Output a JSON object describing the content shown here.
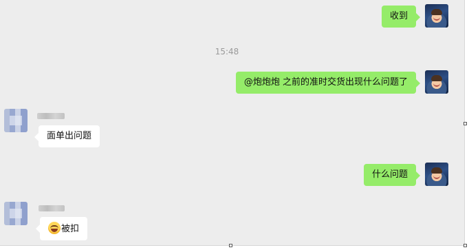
{
  "chat": {
    "messages": [
      {
        "sender": "me",
        "text": "收到"
      },
      {
        "type": "timestamp",
        "text": "15:48"
      },
      {
        "sender": "me",
        "text": "@炮炮炮  之前的准时交货出现什么问题了"
      },
      {
        "sender": "other",
        "text": "面单出问题"
      },
      {
        "sender": "me",
        "text": "什么问题"
      },
      {
        "sender": "other",
        "emoji": "laugh-cry-emoji",
        "text": "被扣"
      }
    ]
  },
  "colors": {
    "panel_bg": "#ededed",
    "my_bubble": "#95ec69",
    "other_bubble": "#ffffff",
    "timestamp_text": "#9a9a9a"
  }
}
